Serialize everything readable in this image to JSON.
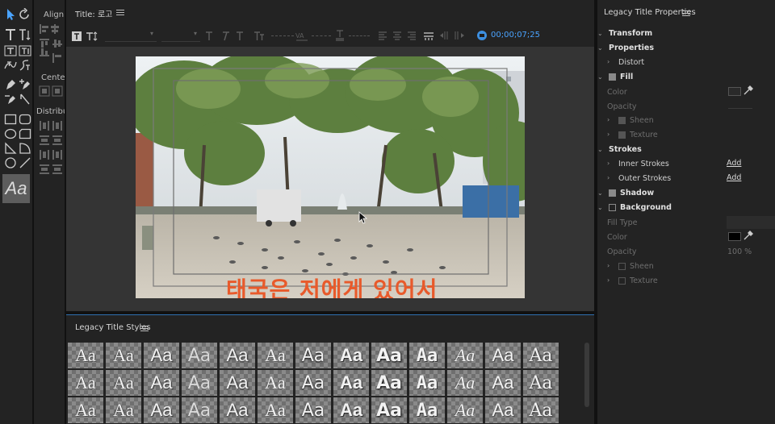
{
  "tools_panel": {
    "tools": [
      "selection-tool",
      "rotation-tool",
      "type-tool",
      "vertical-type-tool",
      "area-type-tool",
      "vertical-area-type-tool",
      "path-type-tool",
      "vertical-path-type-tool",
      "pen-tool",
      "add-anchor-tool",
      "delete-anchor-tool",
      "convert-anchor-tool",
      "rectangle-tool",
      "rounded-rectangle-tool",
      "ellipse-tool",
      "clipped-corner-tool",
      "wedge-tool",
      "arc-tool",
      "ellipse-shape-tool",
      "line-tool"
    ],
    "preview_label": "Aa"
  },
  "actions_panel": {
    "align_label": "Align",
    "center_label": "Center",
    "distribute_label": "Distribute"
  },
  "title_panel": {
    "title": "Title: 로고",
    "timecode": "00;00;07;25",
    "subtitle_text": "태국은 저에게 있어서"
  },
  "styles_panel": {
    "title": "Legacy Title Styles",
    "sample": "Aa",
    "rows": [
      [
        "s1",
        "s2",
        "s3",
        "s4",
        "s5",
        "s6",
        "s7",
        "s8",
        "s9",
        "s10",
        "s11",
        "s12",
        "s13"
      ],
      [
        "s1",
        "s2",
        "s3",
        "s4",
        "s5",
        "s6",
        "s7",
        "s8",
        "s9",
        "s10",
        "s11",
        "s12",
        "s13"
      ],
      [
        "s1",
        "s2",
        "s3",
        "s4",
        "s5",
        "s6",
        "s7",
        "s8",
        "s9",
        "s10",
        "s11",
        "s12",
        "s13"
      ]
    ]
  },
  "properties_panel": {
    "title": "Legacy Title Properties",
    "transform": "Transform",
    "properties": "Properties",
    "distort": "Distort",
    "fill": "Fill",
    "color": "Color",
    "opacity": "Opacity",
    "sheen": "Sheen",
    "texture": "Texture",
    "strokes": "Strokes",
    "inner_strokes": "Inner Strokes",
    "outer_strokes": "Outer Strokes",
    "add": "Add",
    "shadow": "Shadow",
    "background": "Background",
    "fill_type": "Fill Type",
    "bg_color": "Color",
    "bg_opacity": "Opacity",
    "bg_opacity_value": "100 %",
    "bg_sheen": "Sheen",
    "bg_texture": "Texture",
    "bg_swatch_color": "#000000"
  }
}
